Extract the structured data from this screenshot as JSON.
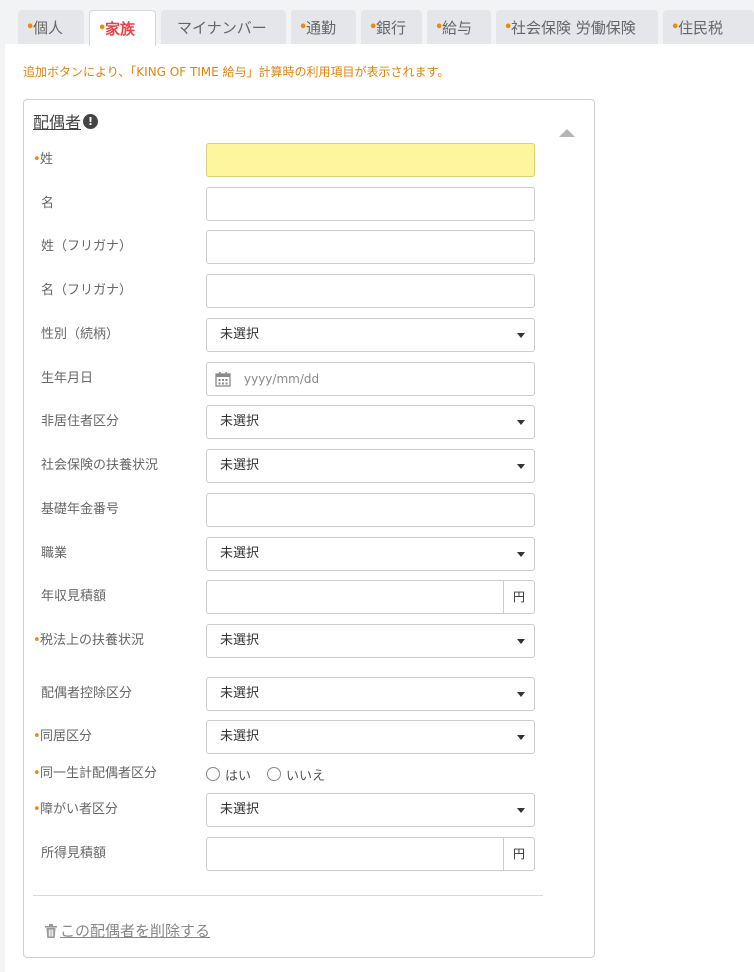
{
  "tabs": [
    {
      "label": "個人",
      "required": true,
      "active": false
    },
    {
      "label": "家族",
      "required": true,
      "active": true
    },
    {
      "label": "マイナンバー",
      "required": false,
      "active": false
    },
    {
      "label": "通勤",
      "required": true,
      "active": false
    },
    {
      "label": "銀行",
      "required": true,
      "active": false
    },
    {
      "label": "給与",
      "required": true,
      "active": false
    },
    {
      "label": "社会保険 労働保険",
      "required": true,
      "active": false
    },
    {
      "label": "住民税",
      "required": true,
      "active": false
    }
  ],
  "notice": "追加ボタンにより、「KING OF TIME 給与」計算時の利用項目が表示されます。",
  "card": {
    "title": "配偶者",
    "info_icon": "!",
    "delete_label": "この配偶者を削除する"
  },
  "fields": {
    "last_name": {
      "label": "姓",
      "required": true
    },
    "first_name": {
      "label": "名",
      "required": false
    },
    "last_name_kana": {
      "label": "姓（フリガナ）",
      "required": false
    },
    "first_name_kana": {
      "label": "名（フリガナ）",
      "required": false
    },
    "gender": {
      "label": "性別（続柄）",
      "required": false,
      "value": "未選択"
    },
    "birthdate": {
      "label": "生年月日",
      "required": false,
      "placeholder": "yyyy/mm/dd"
    },
    "nonresident": {
      "label": "非居住者区分",
      "required": false,
      "value": "未選択"
    },
    "social_dependent": {
      "label": "社会保険の扶養状況",
      "required": false,
      "value": "未選択"
    },
    "pension_number": {
      "label": "基礎年金番号",
      "required": false
    },
    "occupation": {
      "label": "職業",
      "required": false,
      "value": "未選択"
    },
    "annual_income": {
      "label": "年収見積額",
      "required": false,
      "unit": "円"
    },
    "tax_dependent": {
      "label": "税法上の扶養状況",
      "required": true,
      "value": "未選択"
    },
    "spouse_deduction": {
      "label": "配偶者控除区分",
      "required": false,
      "value": "未選択"
    },
    "cohabitation": {
      "label": "同居区分",
      "required": true,
      "value": "未選択"
    },
    "same_household": {
      "label": "同一生計配偶者区分",
      "required": true,
      "options": [
        "はい",
        "いいえ"
      ]
    },
    "disability": {
      "label": "障がい者区分",
      "required": true,
      "value": "未選択"
    },
    "income_estimate": {
      "label": "所得見積額",
      "required": false,
      "unit": "円"
    }
  },
  "colors": {
    "required_dot": "#f08a00",
    "active_tab": "#e8434b",
    "notice": "#e0820a",
    "highlight_field": "#fff59d"
  }
}
